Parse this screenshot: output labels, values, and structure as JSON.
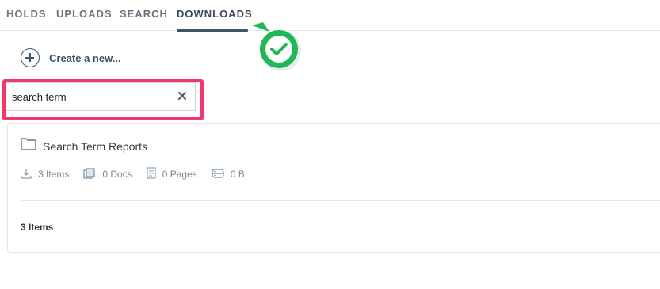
{
  "tabs": [
    {
      "label": "HOLDS"
    },
    {
      "label": "UPLOADS"
    },
    {
      "label": "SEARCH"
    },
    {
      "label": "DOWNLOADS",
      "active": true
    }
  ],
  "create": {
    "label": "Create a new..."
  },
  "search": {
    "value": "search term",
    "clear_icon": "close-icon"
  },
  "folder": {
    "title": "Search Term Reports",
    "stats": {
      "items": "3 Items",
      "docs": "0 Docs",
      "pages": "0 Pages",
      "size": "0 B"
    },
    "footer": "3 Items"
  },
  "colors": {
    "accent": "#35556b",
    "highlight": "#f0386b",
    "check_green": "#1db954"
  }
}
